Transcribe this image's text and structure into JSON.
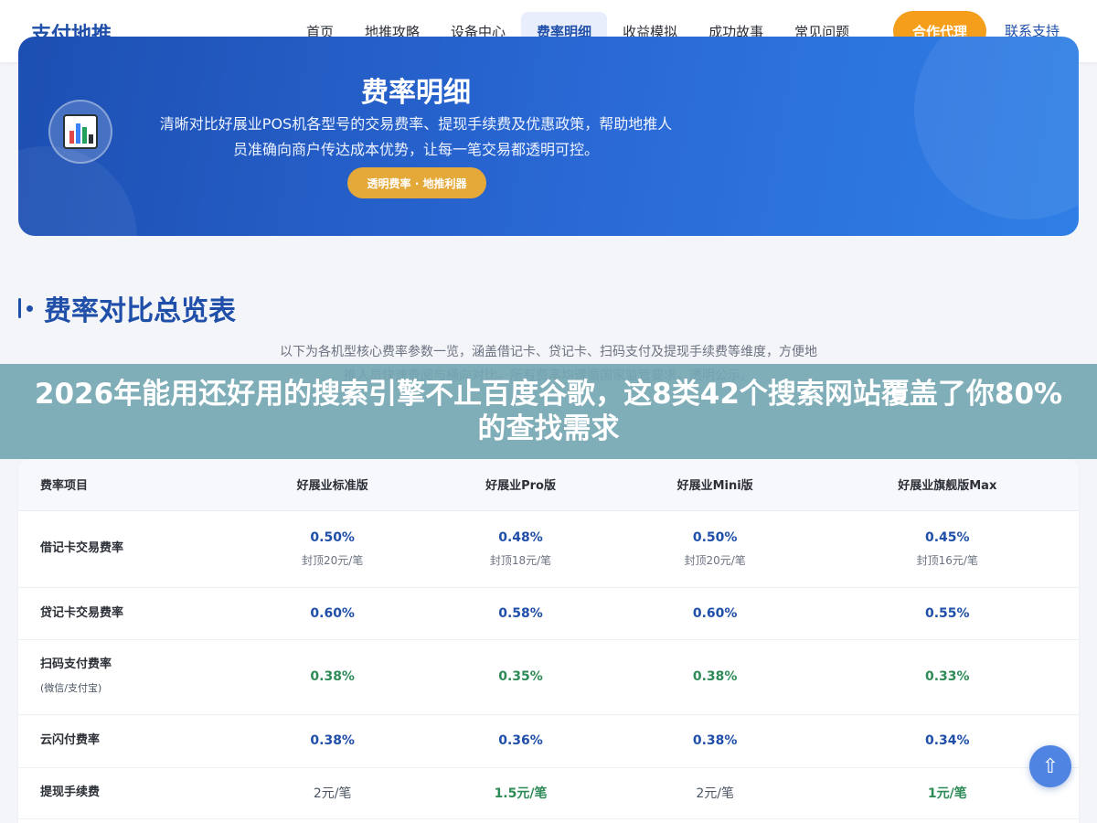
{
  "header": {
    "logo": "支付地推",
    "nav": [
      "首页",
      "地推攻略",
      "设备中心",
      "费率明细",
      "收益模拟",
      "成功故事",
      "常见问题"
    ],
    "active_nav": "费率明细",
    "agent_button": "合作代理",
    "contact_link": "联系支持"
  },
  "hero": {
    "title": "费率明细",
    "desc_line1": "清晰对比好展业POS机各型号的交易费率、提现手续费及优惠政策，帮助地推人",
    "desc_line2": "员准确向商户传达成本优势，让每一笔交易都透明可控。",
    "tag": "透明费率 · 地推利器",
    "icon": "bar-chart-icon"
  },
  "section": {
    "title": "费率对比总览表",
    "desc": "以下为各机型核心费率参数一览，涵盖借记卡、贷记卡、扫码支付及提现手续费等维度，方便地推人员快速查阅与横向对比。所有费率均遵循国家监管要求，透明公示。"
  },
  "banner": {
    "text": "2026年能用还好用的搜索引擎不止百度谷歌，这8类42个搜索网站覆盖了你80%的查找需求"
  },
  "table": {
    "headers": [
      "费率项目",
      "好展业标准版",
      "好展业Pro版",
      "好展业Mini版",
      "好展业旗舰版Max"
    ],
    "rows": [
      {
        "label": "借记卡交易费率",
        "cells": [
          {
            "value": "0.50%",
            "cap": "封顶20元/笔",
            "style": "blue"
          },
          {
            "value": "0.48%",
            "cap": "封顶18元/笔",
            "style": "blue"
          },
          {
            "value": "0.50%",
            "cap": "封顶20元/笔",
            "style": "blue"
          },
          {
            "value": "0.45%",
            "cap": "封顶16元/笔",
            "style": "blue"
          }
        ]
      },
      {
        "label": "贷记卡交易费率",
        "cells": [
          {
            "value": "0.60%",
            "style": "blue"
          },
          {
            "value": "0.58%",
            "style": "blue"
          },
          {
            "value": "0.60%",
            "style": "blue"
          },
          {
            "value": "0.55%",
            "style": "blue"
          }
        ]
      },
      {
        "label": "扫码支付费率",
        "sub_label": "(微信/支付宝)",
        "cells": [
          {
            "value": "0.38%",
            "style": "green"
          },
          {
            "value": "0.35%",
            "style": "green"
          },
          {
            "value": "0.38%",
            "style": "green"
          },
          {
            "value": "0.33%",
            "style": "green"
          }
        ]
      },
      {
        "label": "云闪付费率",
        "cells": [
          {
            "value": "0.38%",
            "style": "blue"
          },
          {
            "value": "0.36%",
            "style": "blue"
          },
          {
            "value": "0.38%",
            "style": "blue"
          },
          {
            "value": "0.34%",
            "style": "blue"
          }
        ]
      },
      {
        "label": "提现手续费",
        "cells": [
          {
            "value": "2元/笔",
            "style": "gray"
          },
          {
            "value": "1.5元/笔",
            "style": "green"
          },
          {
            "value": "2元/笔",
            "style": "gray"
          },
          {
            "value": "1元/笔",
            "style": "green"
          }
        ]
      }
    ]
  },
  "scroll_top_icon": "arrow-up-icon",
  "colors": {
    "brand": "#1f4fa8",
    "accent_orange": "#f59e1b",
    "value_green": "#2e8b57",
    "banner": "#75a6b2"
  }
}
